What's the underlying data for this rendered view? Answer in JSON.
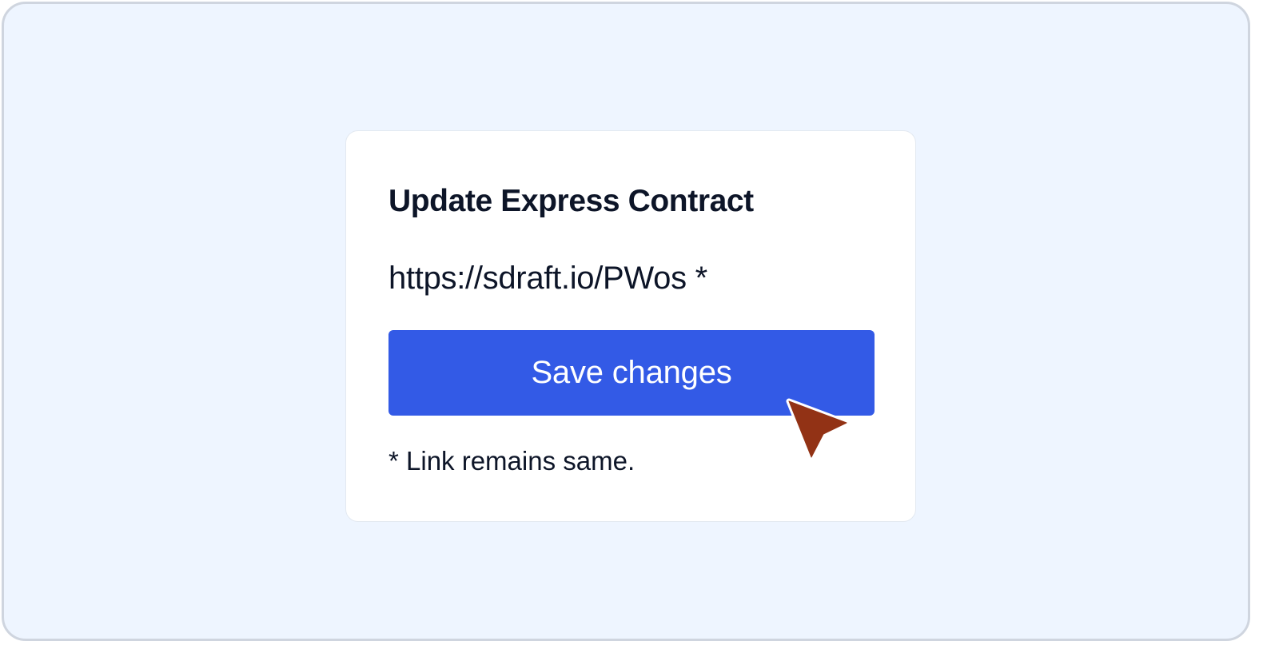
{
  "dialog": {
    "title": "Update Express Contract",
    "url": "https://sdraft.io/PWos *",
    "save_label": "Save changes",
    "note": "* Link remains same."
  },
  "colors": {
    "background": "#eef5ff",
    "card": "#ffffff",
    "primary_button": "#335ae6",
    "text": "#0d1528",
    "cursor": "#923215"
  },
  "icons": {
    "cursor": "mouse-pointer-icon"
  }
}
